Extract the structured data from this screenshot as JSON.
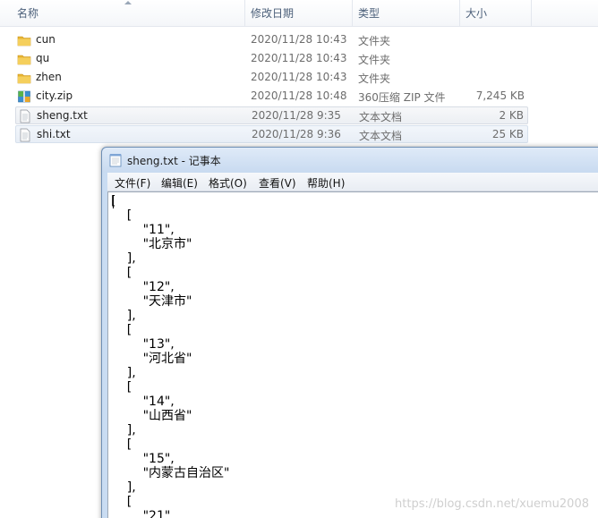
{
  "explorer": {
    "columns": {
      "name": "名称",
      "date": "修改日期",
      "type": "类型",
      "size": "大小"
    },
    "files": [
      {
        "name": "cun",
        "date": "2020/11/28 10:43",
        "type": "文件夹",
        "size": "",
        "icon": "folder-icon"
      },
      {
        "name": "qu",
        "date": "2020/11/28 10:43",
        "type": "文件夹",
        "size": "",
        "icon": "folder-icon"
      },
      {
        "name": "zhen",
        "date": "2020/11/28 10:43",
        "type": "文件夹",
        "size": "",
        "icon": "folder-icon"
      },
      {
        "name": "city.zip",
        "date": "2020/11/28 10:48",
        "type": "360压缩 ZIP 文件",
        "size": "7,245 KB",
        "icon": "zip-archive-icon"
      },
      {
        "name": "sheng.txt",
        "date": "2020/11/28 9:35",
        "type": "文本文档",
        "size": "2 KB",
        "icon": "text-file-icon"
      },
      {
        "name": "shi.txt",
        "date": "2020/11/28 9:36",
        "type": "文本文档",
        "size": "25 KB",
        "icon": "text-file-icon"
      }
    ]
  },
  "notepad": {
    "title": "sheng.txt - 记事本",
    "menu": {
      "file": "文件(F)",
      "edit": "编辑(E)",
      "format": "格式(O)",
      "view": "查看(V)",
      "help": "帮助(H)"
    },
    "content": "[\n    [\n        \"11\",\n        \"北京市\"\n    ],\n    [\n        \"12\",\n        \"天津市\"\n    ],\n    [\n        \"13\",\n        \"河北省\"\n    ],\n    [\n        \"14\",\n        \"山西省\"\n    ],\n    [\n        \"15\",\n        \"内蒙古自治区\"\n    ],\n    [\n        \"21\","
  },
  "watermark": "https://blog.csdn.net/xuemu2008",
  "colors": {
    "folder": "#e8b533",
    "selection": "#eceff3",
    "titlebar": "#c8daf0"
  }
}
